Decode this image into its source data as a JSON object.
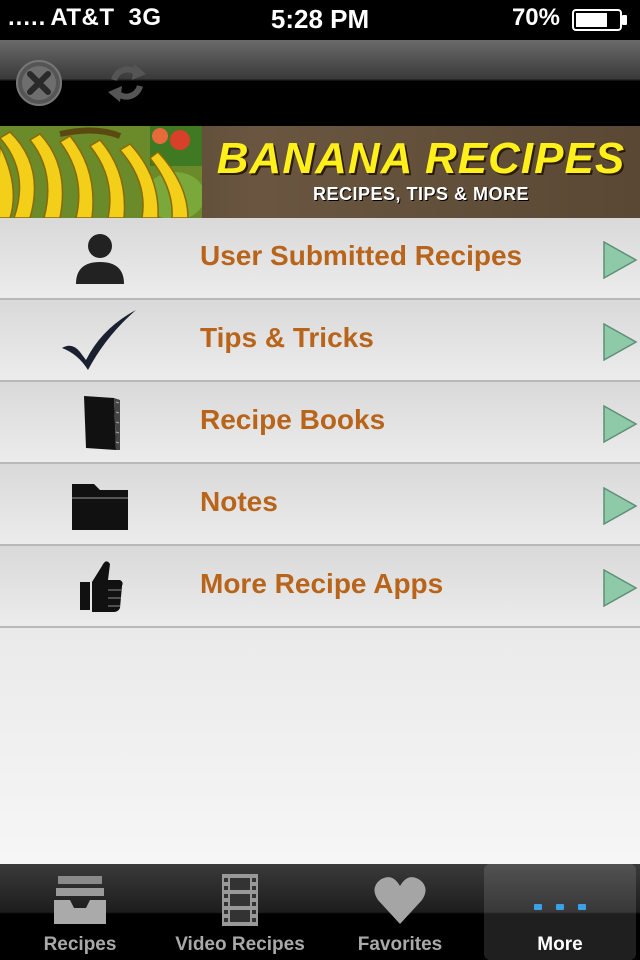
{
  "status_bar": {
    "signal": ".....",
    "carrier": "AT&T",
    "network": "3G",
    "time": "5:28 PM",
    "battery": "70%"
  },
  "toolbar": {
    "close_icon": "close-icon",
    "refresh_icon": "refresh-icon"
  },
  "banner": {
    "title": "BANANA RECIPES",
    "subtitle": "RECIPES, TIPS & MORE"
  },
  "menu": {
    "items": [
      {
        "label": "User Submitted Recipes",
        "icon": "user-icon"
      },
      {
        "label": "Tips & Tricks",
        "icon": "checkmark-icon"
      },
      {
        "label": "Recipe Books",
        "icon": "book-icon"
      },
      {
        "label": "Notes",
        "icon": "folder-icon"
      },
      {
        "label": "More Recipe Apps",
        "icon": "thumbs-up-icon"
      }
    ]
  },
  "tabs": [
    {
      "label": "Recipes",
      "icon": "inbox-tray-icon"
    },
    {
      "label": "Video Recipes",
      "icon": "film-strip-icon"
    },
    {
      "label": "Favorites",
      "icon": "heart-icon"
    },
    {
      "label": "More",
      "icon": "more-dots-icon",
      "selected": true
    }
  ],
  "colors": {
    "menu_label": "#b8641a",
    "banner_title": "#ffef1a",
    "chevron": "#8ec9a8",
    "more_dots": "#3aa0e8"
  }
}
